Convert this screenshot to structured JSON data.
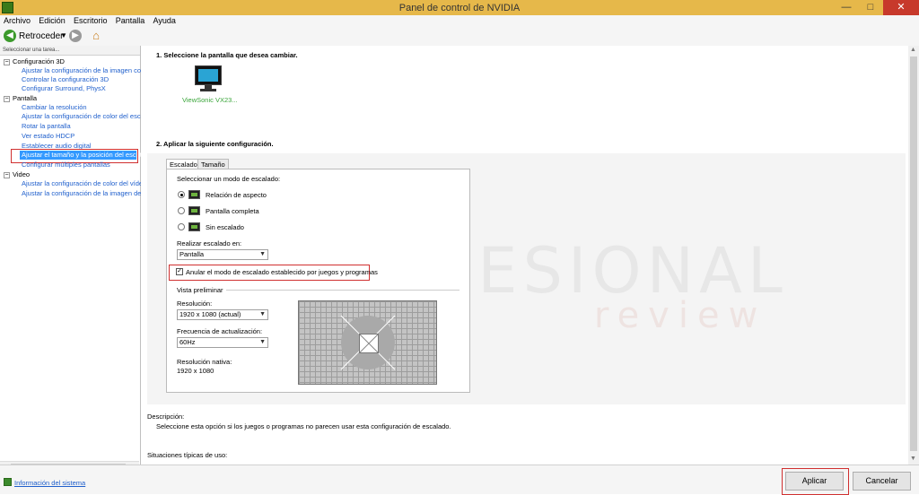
{
  "window": {
    "title": "Panel de control de NVIDIA",
    "minimize": "—",
    "maximize": "□",
    "close": "✕"
  },
  "menu": [
    "Archivo",
    "Edición",
    "Escritorio",
    "Pantalla",
    "Ayuda"
  ],
  "toolbar": {
    "back_label": "Retroceder"
  },
  "sidebar": {
    "header": "Seleccionar una tarea...",
    "groups": [
      {
        "label": "Configuración 3D",
        "items": [
          "Ajustar la configuración de la imagen cor",
          "Controlar la configuración 3D",
          "Configurar Surround, PhysX"
        ]
      },
      {
        "label": "Pantalla",
        "items": [
          "Cambiar la resolución",
          "Ajustar la configuración de color del escr",
          "Rotar la pantalla",
          "Ver estado HDCP",
          "Establecer audio digital",
          "Ajustar el tamaño y la posición del escrit",
          "Configurar múltiples pantallas"
        ]
      },
      {
        "label": "Video",
        "items": [
          "Ajustar la configuración de color del víde",
          "Ajustar la configuración de la imagen de"
        ]
      }
    ]
  },
  "main": {
    "step1": "1. Seleccione la pantalla que desea cambiar.",
    "monitor_label": "ViewSonic VX23...",
    "step2": "2. Aplicar la siguiente configuración.",
    "tabs": [
      "Escalado",
      "Tamaño"
    ],
    "mode_label": "Seleccionar un modo de escalado:",
    "modes": [
      "Relación de aspecto",
      "Pantalla completa",
      "Sin escalado"
    ],
    "perform_on_label": "Realizar escalado en:",
    "perform_on_value": "Pantalla",
    "override_label": "Anular el modo de escalado establecido por juegos y programas",
    "preview_label": "Vista preliminar",
    "resolution_label": "Resolución:",
    "resolution_value": "1920 x 1080 (actual)",
    "refresh_label": "Frecuencia de actualización:",
    "refresh_value": "60Hz",
    "native_label": "Resolución nativa:",
    "native_value": "1920 x 1080",
    "description_label": "Descripción:",
    "description_text": "Seleccione esta opción si los juegos o programas no parecen usar esta configuración de escalado.",
    "typical_label": "Situaciones típicas de uso:"
  },
  "watermark": {
    "top": "PROFESIONAL",
    "bottom": "review"
  },
  "footer": {
    "sysinfo": "Información del sistema",
    "apply": "Aplicar",
    "cancel": "Cancelar"
  }
}
